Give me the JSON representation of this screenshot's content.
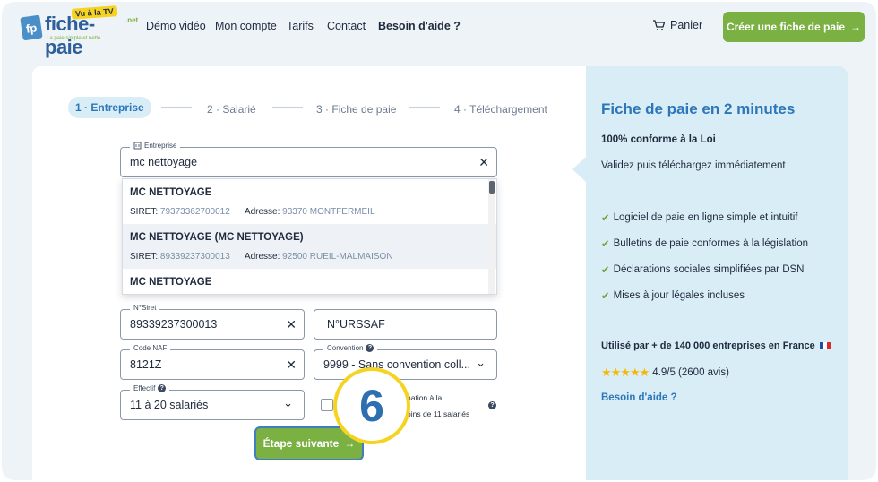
{
  "header": {
    "logo": {
      "box": "fp",
      "word": "fiche-paie",
      "badge": "Vu à la TV",
      "net": ".net",
      "tagline": "La paie simple et nette"
    },
    "nav": [
      "Démo vidéo",
      "Mon compte",
      "Tarifs",
      "Contact",
      "Besoin d'aide ?"
    ],
    "cart_label": "Panier",
    "cta_label": "Créer une fiche de paie"
  },
  "stepper": [
    {
      "num": "1",
      "label": "Entreprise"
    },
    {
      "num": "2",
      "label": "Salarié"
    },
    {
      "num": "3",
      "label": "Fiche de paie"
    },
    {
      "num": "4",
      "label": "Téléchargement"
    }
  ],
  "form": {
    "entreprise_label": "Entreprise",
    "entreprise_value": "mc nettoyage",
    "siret_label": "N°Siret",
    "siret_value": "89339237300013",
    "urssaf_placeholder": "N°URSSAF",
    "naf_label": "Code NAF",
    "naf_value": "8121Z",
    "convention_label": "Convention",
    "convention_value": "9999 - Sans convention coll...",
    "effectif_label": "Effectif",
    "effectif_value": "11 à 20 salariés",
    "checkbox_text_line1": "nation à la",
    "checkbox_text_line2": "oins de 11 salariés",
    "next_label": "Étape suivante"
  },
  "dropdown": [
    {
      "name": "MC NETTOYAGE",
      "siret_label": "SIRET:",
      "siret": "79373362700012",
      "addr_label": "Adresse:",
      "addr": "93370 MONTFERMEIL"
    },
    {
      "name": "MC NETTOYAGE (MC NETTOYAGE)",
      "siret_label": "SIRET:",
      "siret": "89339237300013",
      "addr_label": "Adresse:",
      "addr": "92500 RUEIL-MALMAISON"
    },
    {
      "name": "MC NETTOYAGE"
    }
  ],
  "step_badge": "6",
  "panel": {
    "title": "Fiche de paie en 2 minutes",
    "subtitle": "100% conforme à la Loi",
    "line": "Validez puis téléchargez immédiatement",
    "features": [
      "Logiciel de paie en ligne simple et intuitif",
      "Bulletins de paie conformes à la législation",
      "Déclarations sociales simplifiées par DSN",
      "Mises à jour légales incluses"
    ],
    "used_by": "Utilisé par + de 140 000 entreprises en France",
    "rating_text": "4.9/5 (2600 avis)",
    "stars": "★★★★★",
    "help": "Besoin d'aide ?"
  },
  "colors": {
    "green": "#7bb043",
    "blue": "#2d76b8",
    "panel": "#d9edf7",
    "yellow": "#f5d320"
  }
}
